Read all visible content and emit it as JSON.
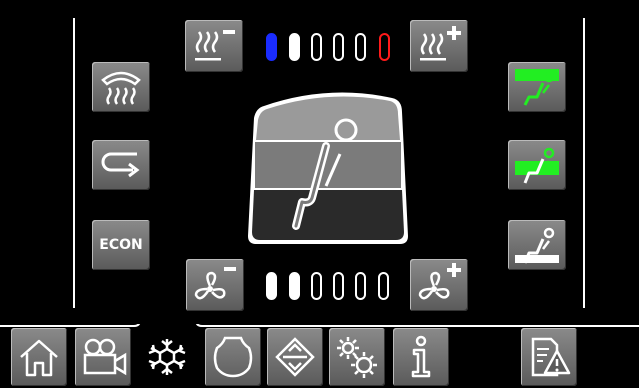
{
  "defrost_up_icon": "defrost-icon",
  "recirc_icon": "recirculation-icon",
  "econ_label": "ECON",
  "heat_minus_icon": "heat-minus-icon",
  "heat_plus_icon": "heat-plus-icon",
  "fan_minus_icon": "fan-minus-icon",
  "fan_plus_icon": "fan-plus-icon",
  "temperature_level": {
    "total": 6,
    "current": 2,
    "min_color": "#1a2cff",
    "max_color": "#ff1a1a"
  },
  "fan_level": {
    "total": 6,
    "current": 2
  },
  "airflow_modes": [
    {
      "name": "upper-airflow-icon",
      "active": true
    },
    {
      "name": "middle-airflow-icon",
      "active": true
    },
    {
      "name": "floor-airflow-icon",
      "active": false
    }
  ],
  "accent_color": "#22ee22",
  "tabs": [
    {
      "name": "home-icon"
    },
    {
      "name": "camera-icon"
    },
    {
      "name": "climate-icon",
      "active": true
    },
    {
      "name": "engine-icon"
    },
    {
      "name": "suspension-icon"
    },
    {
      "name": "settings-icon"
    },
    {
      "name": "info-icon"
    },
    {
      "name": "warning-log-icon"
    }
  ]
}
